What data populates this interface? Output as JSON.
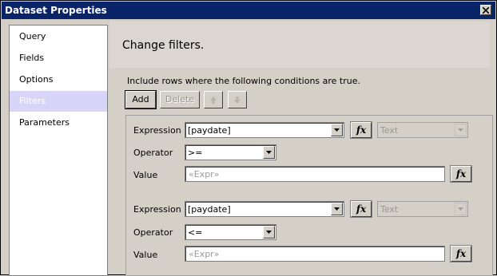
{
  "window": {
    "title": "Dataset Properties",
    "close_label": "✕"
  },
  "nav": {
    "items": [
      {
        "label": "Query",
        "selected": false
      },
      {
        "label": "Fields",
        "selected": false
      },
      {
        "label": "Options",
        "selected": false
      },
      {
        "label": "Filters",
        "selected": true
      },
      {
        "label": "Parameters",
        "selected": false
      }
    ]
  },
  "header": {
    "title": "Change filters."
  },
  "instruction": "Include rows where the following conditions are true.",
  "toolbar": {
    "add_label": "Add",
    "delete_label": "Delete",
    "move_up_icon": "arrow-up-icon",
    "move_down_icon": "arrow-down-icon"
  },
  "filters": [
    {
      "expression_label": "Expression",
      "expression_value": "[paydate]",
      "type_value": "Text",
      "operator_label": "Operator",
      "operator_value": ">=",
      "value_label": "Value",
      "value_placeholder": "«Expr»",
      "fx_label": "fx"
    },
    {
      "expression_label": "Expression",
      "expression_value": "[paydate]",
      "type_value": "Text",
      "operator_label": "Operator",
      "operator_value": "<=",
      "value_label": "Value",
      "value_placeholder": "«Expr»",
      "fx_label": "fx"
    }
  ],
  "colors": {
    "title_bar": "#0a246a",
    "selected_nav": "#d8d6f8",
    "header_band": "#dcd6d2",
    "dialog_face": "#d4d0c8"
  }
}
